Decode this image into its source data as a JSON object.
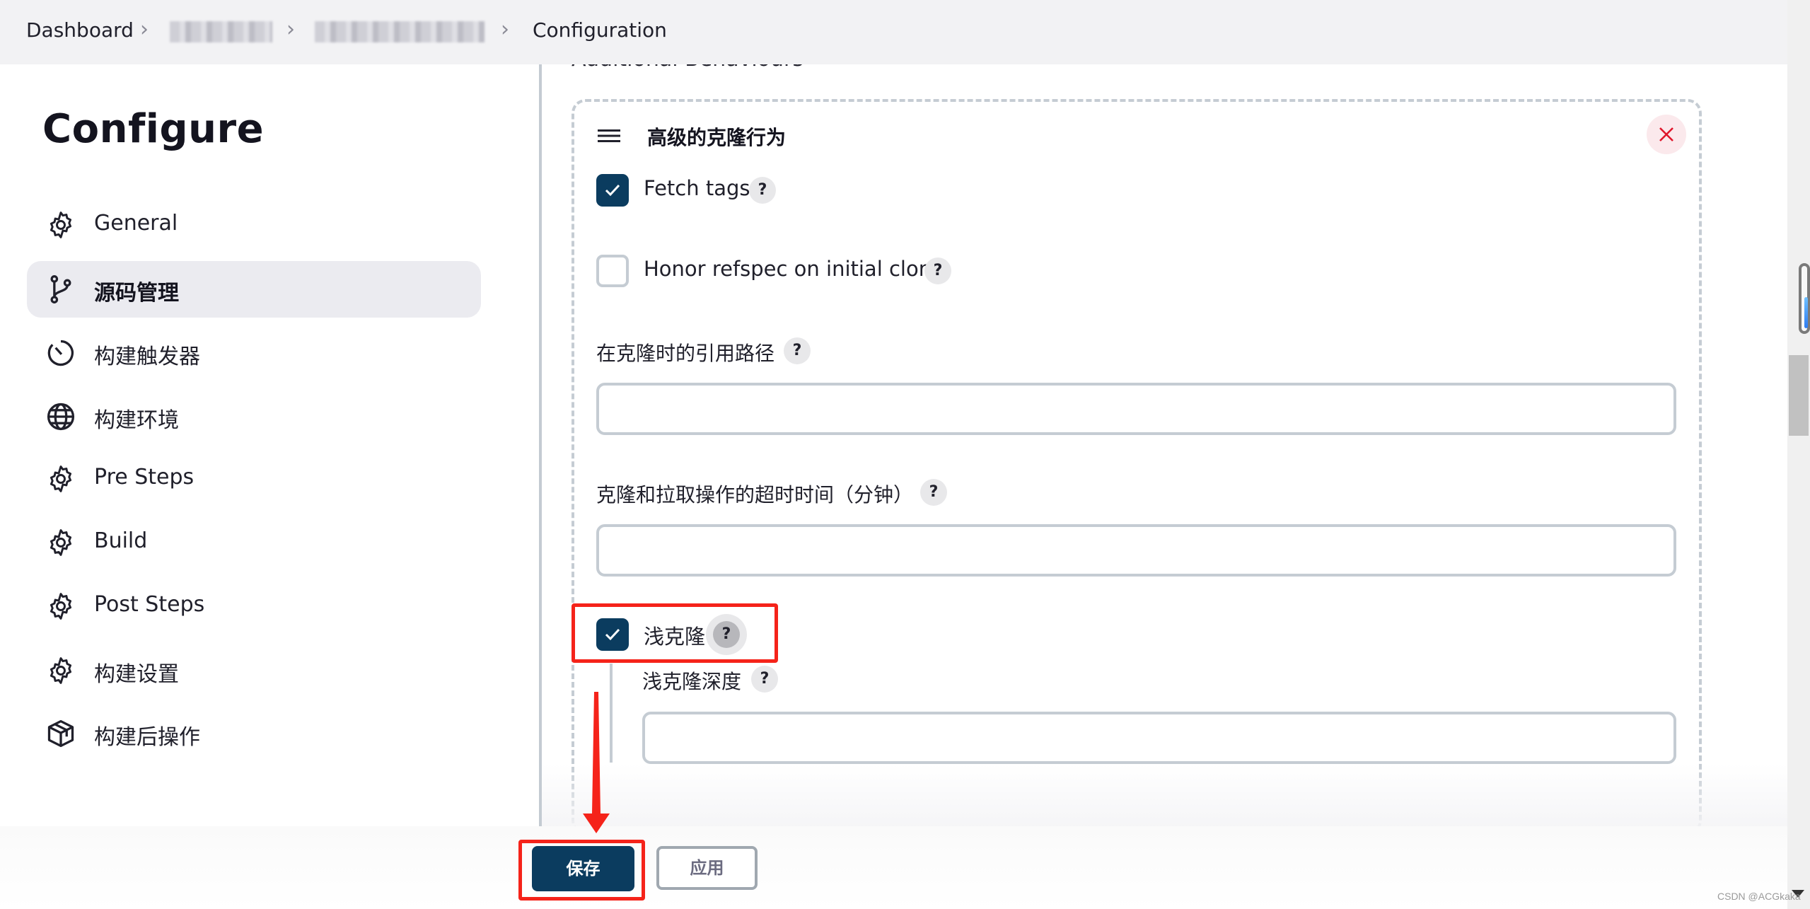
{
  "breadcrumb": {
    "items": [
      "Dashboard",
      "[redacted]",
      "[redacted]",
      "Configuration"
    ],
    "separator_icon": "chevron-right-icon"
  },
  "sidebar": {
    "title": "Configure",
    "items": [
      {
        "label": "General",
        "icon": "gear-icon",
        "active": false
      },
      {
        "label": "源码管理",
        "icon": "git-branch-icon",
        "active": true
      },
      {
        "label": "构建触发器",
        "icon": "timer-icon",
        "active": false
      },
      {
        "label": "构建环境",
        "icon": "globe-icon",
        "active": false
      },
      {
        "label": "Pre Steps",
        "icon": "gear-icon",
        "active": false
      },
      {
        "label": "Build",
        "icon": "gear-icon",
        "active": false
      },
      {
        "label": "Post Steps",
        "icon": "gear-icon",
        "active": false
      },
      {
        "label": "构建设置",
        "icon": "gear-icon",
        "active": false
      },
      {
        "label": "构建后操作",
        "icon": "package-icon",
        "active": false
      }
    ]
  },
  "main": {
    "section_hint": "Additional Behaviours",
    "card": {
      "title": "高级的克隆行为",
      "options": {
        "fetch_tags": {
          "label": "Fetch tags",
          "checked": true,
          "help": "?"
        },
        "honor_refspec": {
          "label": "Honor refspec on initial clone",
          "checked": false,
          "help": "?"
        },
        "shallow_clone": {
          "label": "浅克隆",
          "checked": true,
          "help": "?"
        }
      },
      "fields": {
        "reference_path": {
          "label": "在克隆时的引用路径",
          "value": "",
          "help": "?"
        },
        "timeout": {
          "label": "克隆和拉取操作的超时时间（分钟）",
          "value": "",
          "help": "?"
        },
        "shallow_depth": {
          "label": "浅克隆深度",
          "value": "",
          "help": "?"
        }
      }
    }
  },
  "actions": {
    "save_label": "保存",
    "apply_label": "应用"
  },
  "colors": {
    "primary": "#0b3c5f",
    "annotation_red": "#f5231a",
    "close_red": "#e0162b"
  },
  "watermark": "CSDN @ACGkaka"
}
